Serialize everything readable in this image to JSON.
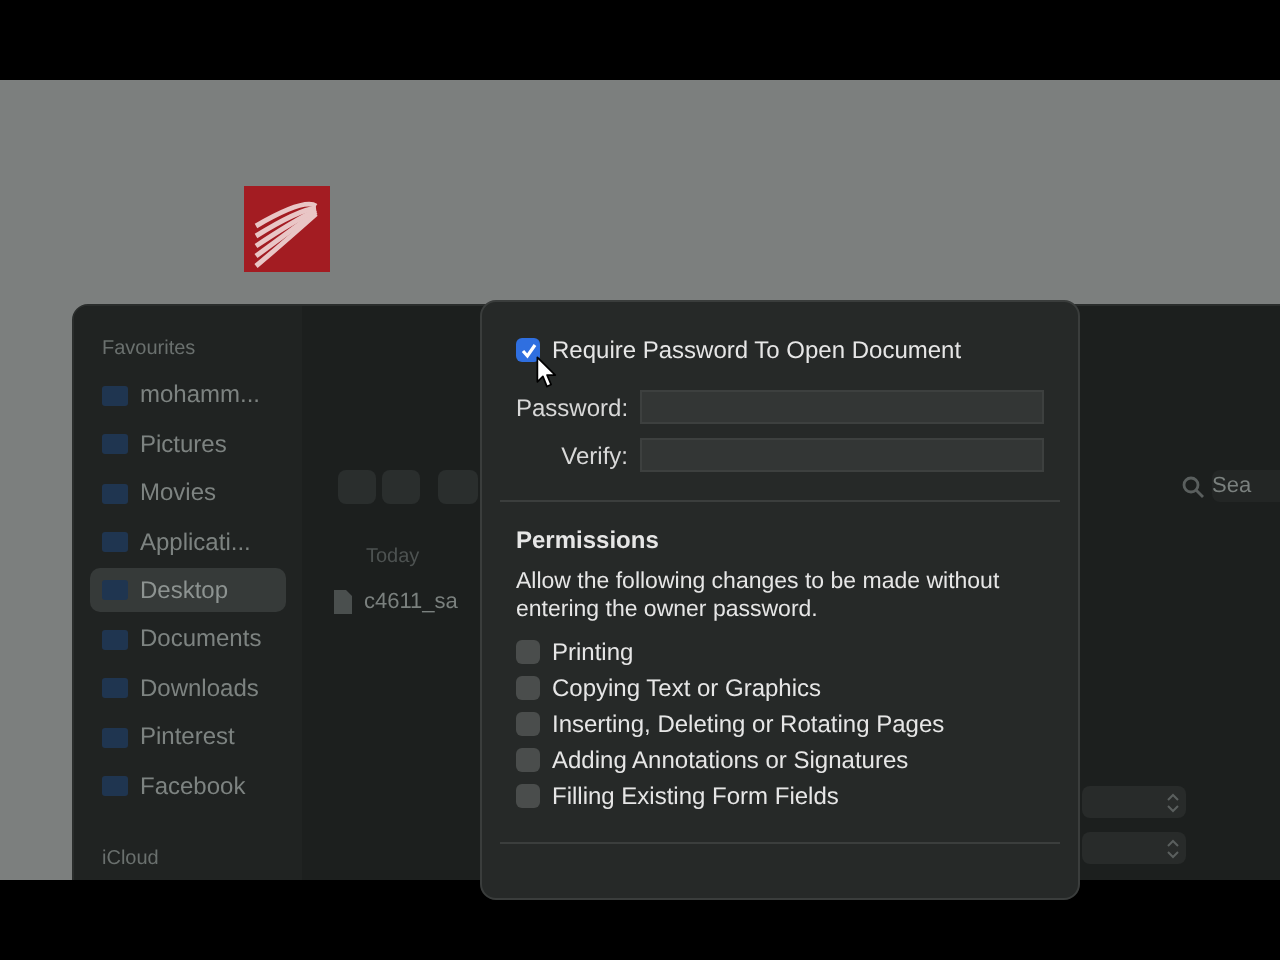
{
  "sidebar": {
    "sections": [
      {
        "title": "Favourites",
        "items": [
          {
            "label": "mohamm...",
            "selected": false
          },
          {
            "label": "Pictures",
            "selected": false
          },
          {
            "label": "Movies",
            "selected": false
          },
          {
            "label": "Applicati...",
            "selected": false
          },
          {
            "label": "Desktop",
            "selected": true
          },
          {
            "label": "Documents",
            "selected": false
          },
          {
            "label": "Downloads",
            "selected": false
          },
          {
            "label": "Pinterest",
            "selected": false
          },
          {
            "label": "Facebook",
            "selected": false
          }
        ]
      },
      {
        "title": "iCloud"
      }
    ]
  },
  "browser": {
    "group_heading": "Today",
    "files": [
      "c4611_sa"
    ],
    "search": {
      "placeholder": "Sea"
    }
  },
  "dialog": {
    "require_password": {
      "label": "Require Password To Open Document",
      "checked": true
    },
    "fields": [
      {
        "label": "Password:"
      },
      {
        "label": "Verify:"
      }
    ],
    "permissions": {
      "heading": "Permissions",
      "description": "Allow the following changes to be made without entering the owner password.",
      "options": [
        {
          "label": "Printing",
          "checked": false
        },
        {
          "label": "Copying Text or Graphics",
          "checked": false
        },
        {
          "label": "Inserting, Deleting or Rotating Pages",
          "checked": false
        },
        {
          "label": "Adding Annotations or Signatures",
          "checked": false
        },
        {
          "label": "Filling Existing Form Fields",
          "checked": false
        }
      ]
    }
  }
}
